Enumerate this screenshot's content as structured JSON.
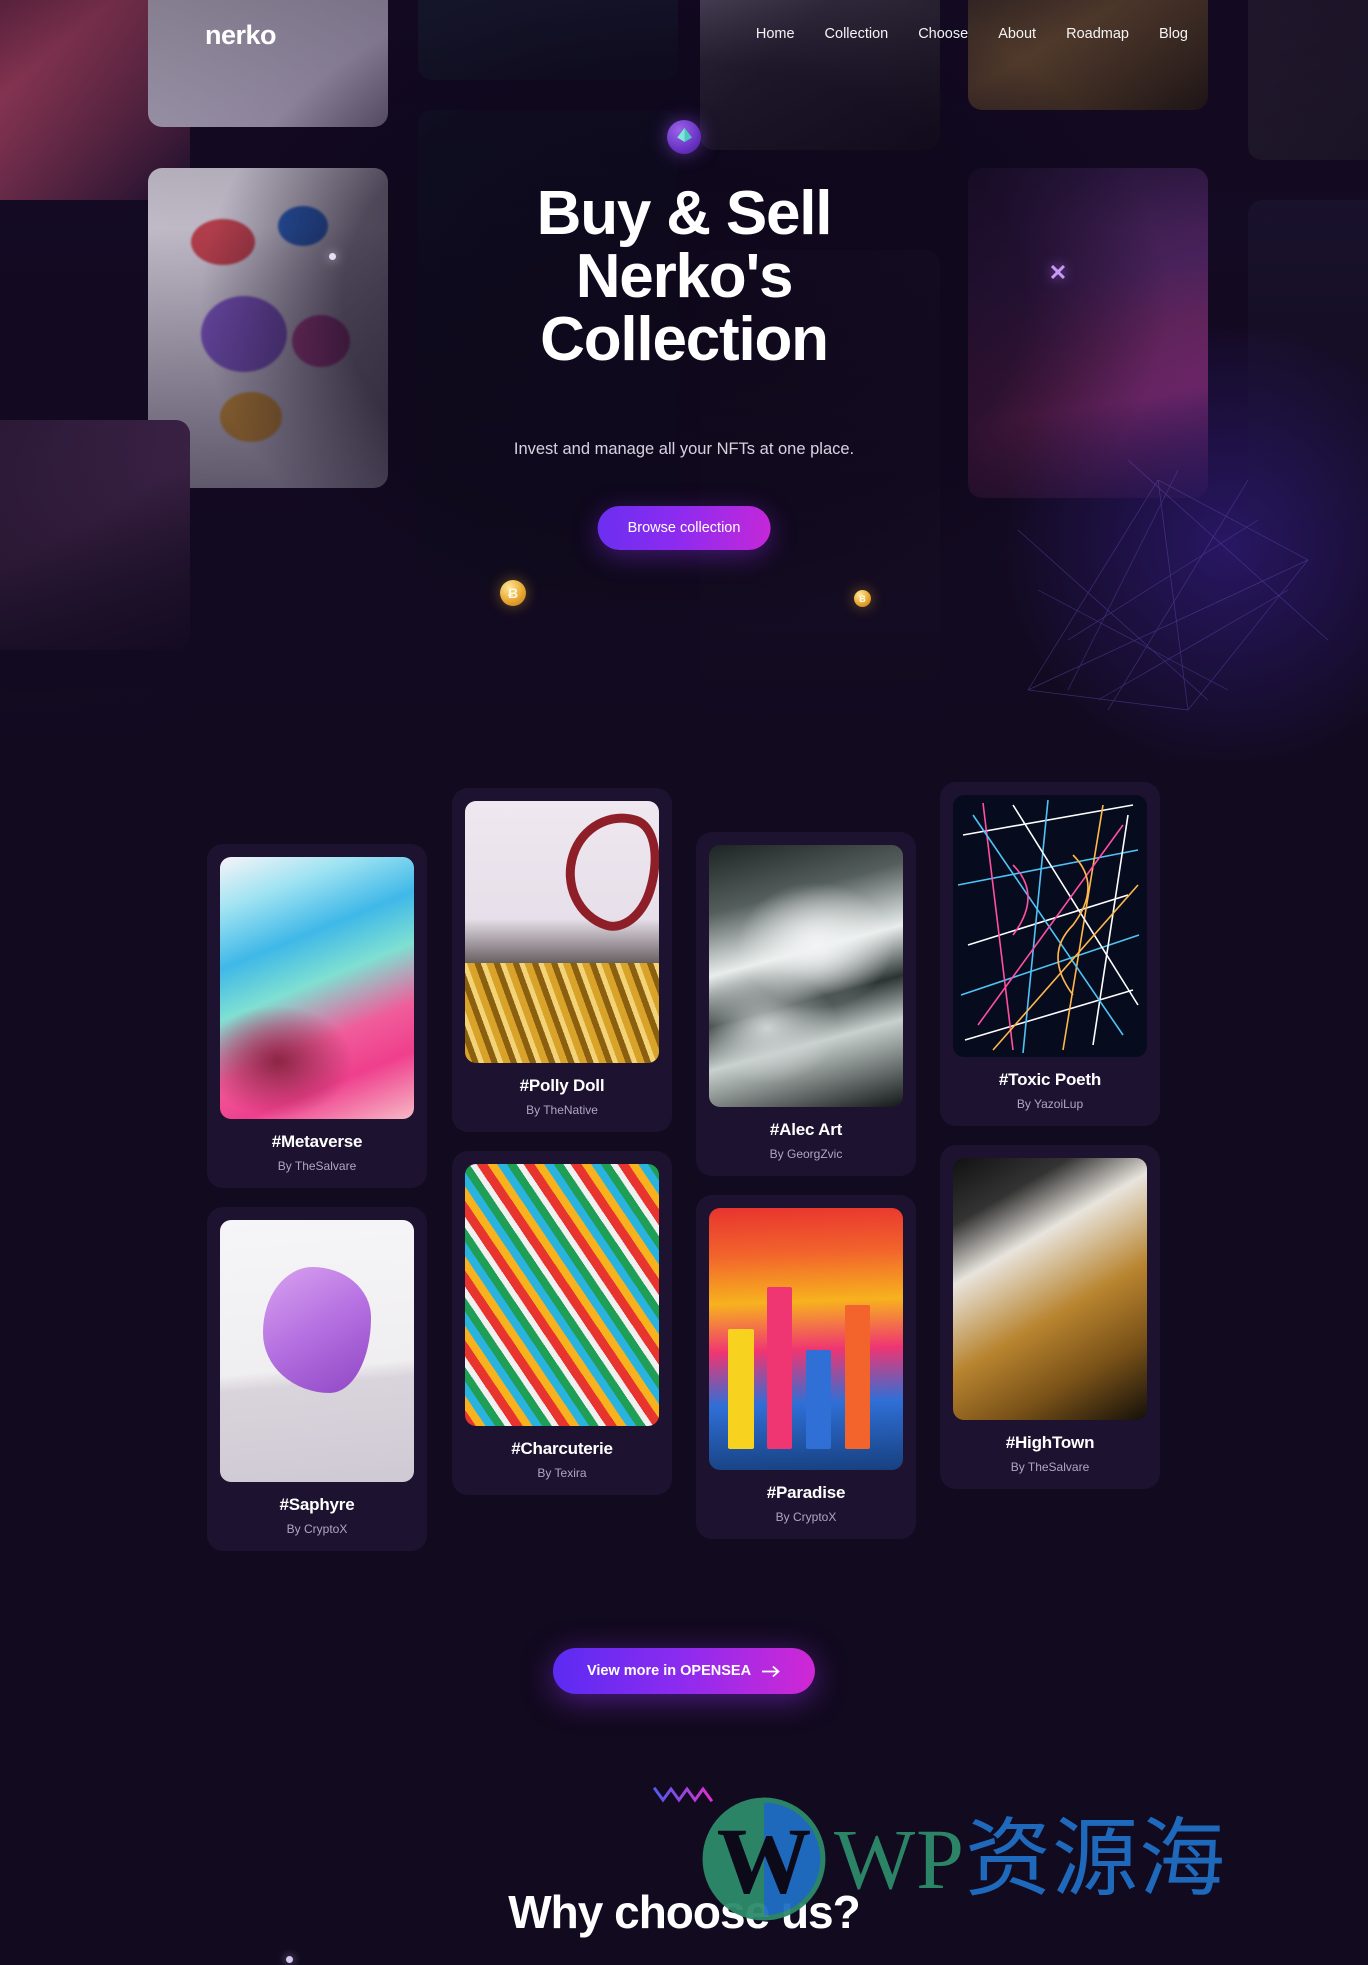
{
  "brand": {
    "logo": "nerko"
  },
  "nav": {
    "items": [
      {
        "label": "Home"
      },
      {
        "label": "Collection"
      },
      {
        "label": "Choose"
      },
      {
        "label": "About"
      },
      {
        "label": "Roadmap"
      },
      {
        "label": "Blog"
      }
    ]
  },
  "hero": {
    "title_line1": "Buy & Sell",
    "title_line2": "Nerko's",
    "title_line3": "Collection",
    "subtitle": "Invest and manage all your NFTs at one place.",
    "cta_label": "Browse collection",
    "badge_icon": "ethereum-diamond-icon",
    "coin1_symbol": "Ƀ",
    "coin2_symbol": "Ƀ",
    "sparkle_icon": "x-sparkle-icon"
  },
  "collection": {
    "cards": [
      {
        "name": "#Metaverse",
        "author": "By TheSalvare",
        "art": "a-metaverse"
      },
      {
        "name": "#Polly Doll",
        "author": "By TheNative",
        "art": "a-polly"
      },
      {
        "name": "#Alec Art",
        "author": "By GeorgZvic",
        "art": "a-alec"
      },
      {
        "name": "#Toxic Poeth",
        "author": "By YazoiLup",
        "art": "a-toxic"
      },
      {
        "name": "#Saphyre",
        "author": "By CryptoX",
        "art": "a-saphyre"
      },
      {
        "name": "#Charcuterie",
        "author": "By Texira",
        "art": "a-charcuterie"
      },
      {
        "name": "#Paradise",
        "author": "By CryptoX",
        "art": "a-paradise"
      },
      {
        "name": "#HighTown",
        "author": "By TheSalvare",
        "art": "a-hightown"
      }
    ],
    "more_label": "View more in OPENSEA",
    "more_icon": "arrow-right-icon"
  },
  "why": {
    "heading": "Why choose us?",
    "accent_icon": "zigzag-icon"
  },
  "watermark": {
    "logo_icon": "wordpress-logo-icon",
    "text_latin": "WP",
    "text_cn": "资源海"
  },
  "colors": {
    "page_bg": "#120a1f",
    "card_bg": "#1d1330",
    "accent_start": "#6a2ff0",
    "accent_end": "#c528d8",
    "muted_text": "#b0a6c4"
  }
}
